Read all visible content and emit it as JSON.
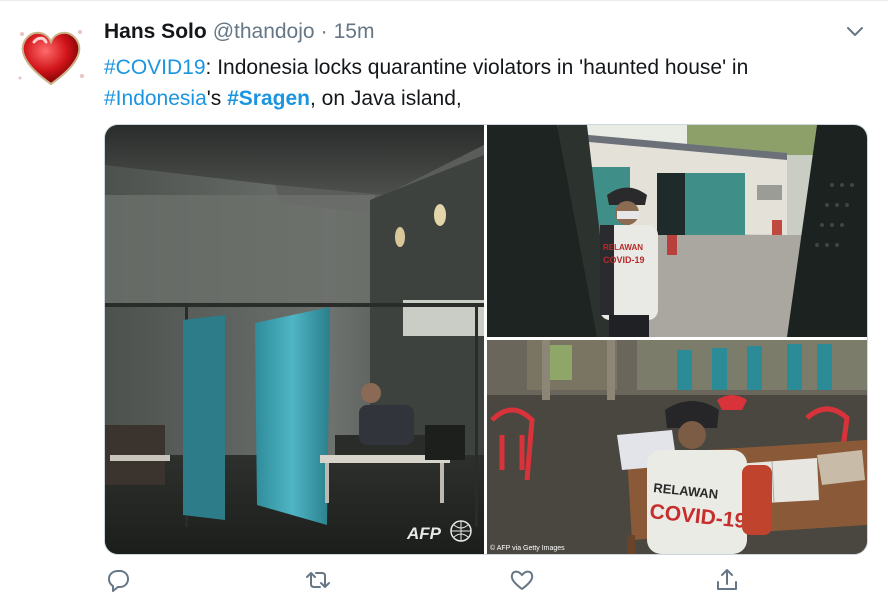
{
  "tweet": {
    "author_name": "Hans Solo",
    "author_handle": "@thandojo",
    "separator": "·",
    "timestamp": "15m",
    "text_parts": {
      "tag_covid": "#COVID19",
      "t1": ": Indonesia locks quarantine violators in 'haunted house' in",
      "tag_indonesia": "#Indonesia",
      "t2": "'s ",
      "tag_sragen": "#Sragen",
      "t3": ", on Java island,"
    }
  },
  "media": {
    "photo1": {
      "watermark": "AFP"
    },
    "photo3": {
      "vest_line1": "RELAWAN",
      "vest_line2": "COVID-19",
      "credit": "© AFP via Getty Images"
    }
  },
  "icons": {
    "avatar": "heart-avatar",
    "caret": "chevron-down-icon",
    "reply": "reply-icon",
    "retweet": "retweet-icon",
    "like": "like-icon",
    "share": "share-icon"
  },
  "colors": {
    "link": "#1b95e0",
    "secondary_text": "#657786",
    "border": "#ccd6dd"
  }
}
